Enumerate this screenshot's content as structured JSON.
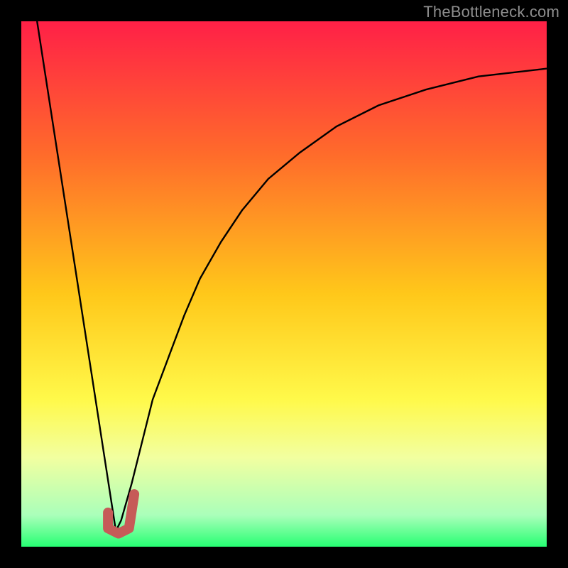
{
  "watermark": {
    "text": "TheBottleneck.com"
  },
  "colors": {
    "frame": "#000000",
    "curve": "#000000",
    "marker": "#c65b58",
    "watermark": "#8e8e8e"
  },
  "chart_data": {
    "type": "line",
    "title": "",
    "xlabel": "",
    "ylabel": "",
    "xlim": [
      0,
      100
    ],
    "ylim": [
      0,
      100
    ],
    "grid": false,
    "gradient_stops": [
      {
        "offset": 0,
        "color": "#ff2047"
      },
      {
        "offset": 25,
        "color": "#ff6a2b"
      },
      {
        "offset": 52,
        "color": "#ffc81a"
      },
      {
        "offset": 72,
        "color": "#fff94a"
      },
      {
        "offset": 83,
        "color": "#f2ffa0"
      },
      {
        "offset": 94,
        "color": "#aaffba"
      },
      {
        "offset": 100,
        "color": "#27ff73"
      }
    ],
    "series": [
      {
        "name": "v-left",
        "x": [
          3,
          18
        ],
        "y": [
          100,
          3
        ]
      },
      {
        "name": "v-right-rise",
        "x": [
          18,
          19,
          21,
          23,
          25,
          28,
          31,
          34,
          38,
          42,
          47,
          53,
          60,
          68,
          77,
          87,
          100
        ],
        "y": [
          3,
          5,
          12,
          20,
          28,
          36,
          44,
          51,
          58,
          64,
          70,
          75,
          80,
          84,
          87,
          89.5,
          91
        ]
      }
    ],
    "marker": {
      "name": "J-marker",
      "path_xy": [
        [
          16.5,
          6.5
        ],
        [
          16.5,
          3.5
        ],
        [
          18.5,
          2.5
        ],
        [
          20.5,
          3.5
        ],
        [
          21.5,
          10.0
        ]
      ],
      "stroke_width_px": 14
    }
  }
}
